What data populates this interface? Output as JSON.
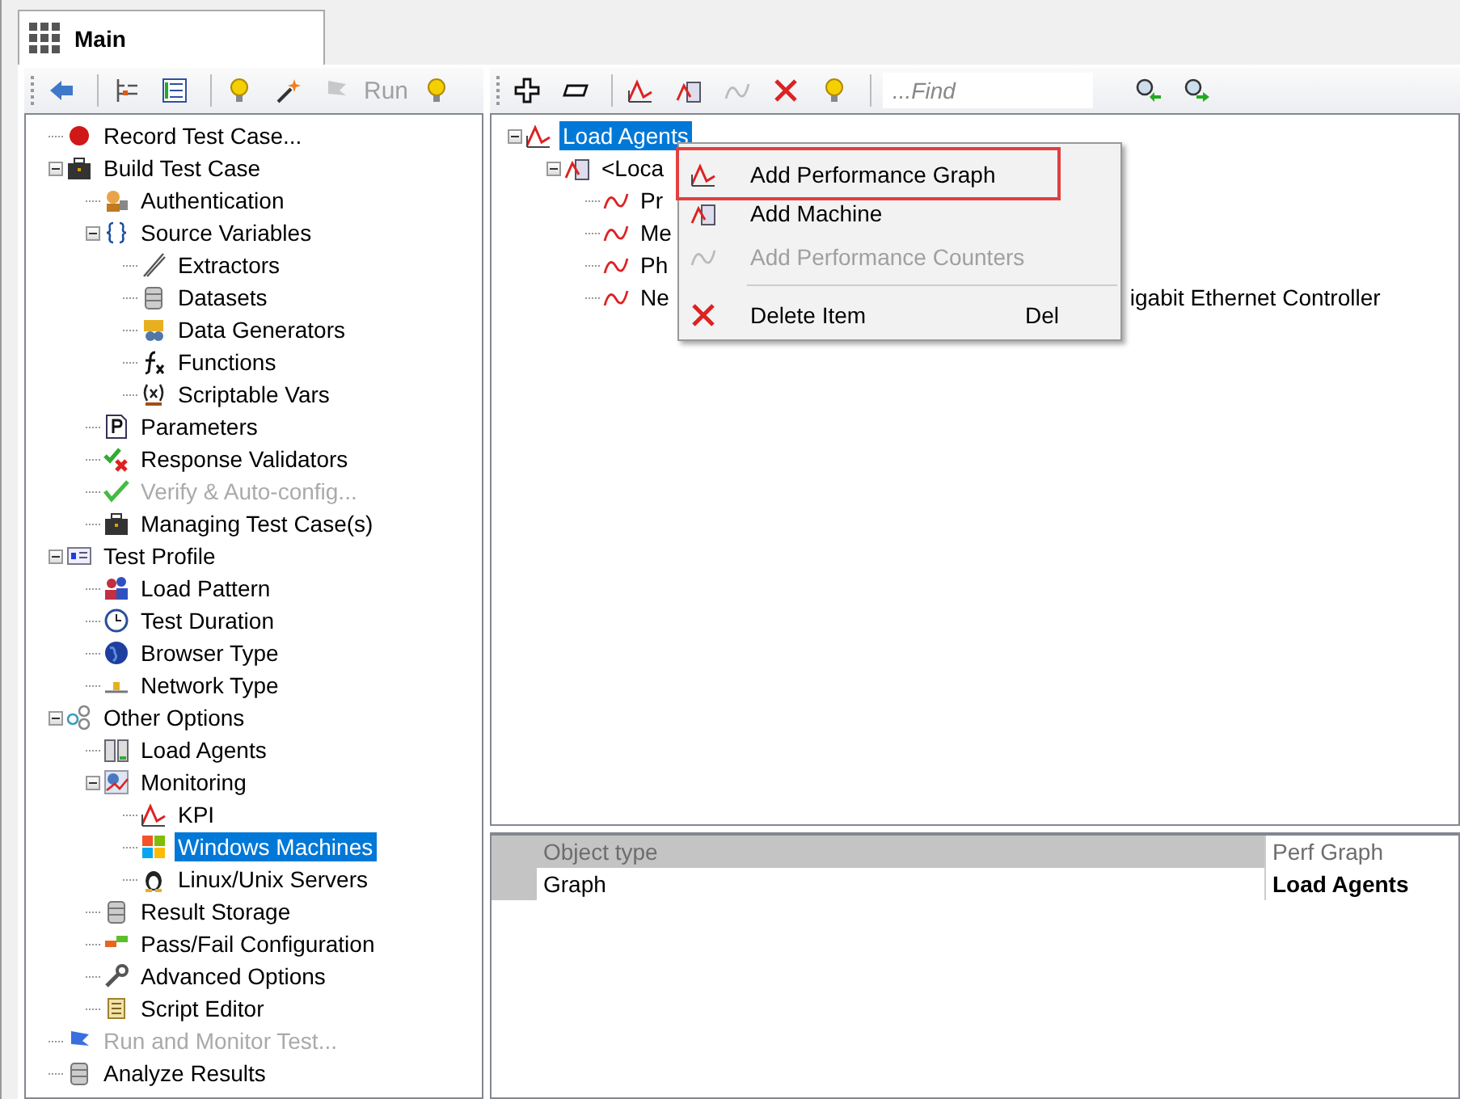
{
  "tabs": [
    {
      "label": "Main",
      "selected": true
    }
  ],
  "left_toolbar": {
    "run_label": "Run",
    "run_disabled": true
  },
  "left_tree": [
    {
      "label": "Record Test Case...",
      "disabled": false,
      "selected": false
    },
    {
      "label": "Build Test Case",
      "disabled": false,
      "selected": false,
      "expanded": true,
      "children": [
        {
          "label": "Authentication",
          "disabled": false,
          "selected": false
        },
        {
          "label": "Source Variables",
          "disabled": false,
          "selected": false,
          "expanded": true,
          "children": [
            {
              "label": "Extractors",
              "disabled": false,
              "selected": false
            },
            {
              "label": "Datasets",
              "disabled": false,
              "selected": false
            },
            {
              "label": "Data Generators",
              "disabled": false,
              "selected": false
            },
            {
              "label": "Functions",
              "disabled": false,
              "selected": false
            },
            {
              "label": "Scriptable Vars",
              "disabled": false,
              "selected": false
            }
          ]
        },
        {
          "label": "Parameters",
          "disabled": false,
          "selected": false
        },
        {
          "label": "Response Validators",
          "disabled": false,
          "selected": false
        },
        {
          "label": "Verify & Auto-config...",
          "disabled": true,
          "selected": false
        },
        {
          "label": "Managing Test Case(s)",
          "disabled": false,
          "selected": false
        }
      ]
    },
    {
      "label": "Test Profile",
      "disabled": false,
      "selected": false,
      "expanded": true,
      "children": [
        {
          "label": "Load Pattern",
          "disabled": false,
          "selected": false
        },
        {
          "label": "Test Duration",
          "disabled": false,
          "selected": false
        },
        {
          "label": "Browser Type",
          "disabled": false,
          "selected": false
        },
        {
          "label": "Network Type",
          "disabled": false,
          "selected": false
        }
      ]
    },
    {
      "label": "Other Options",
      "disabled": false,
      "selected": false,
      "expanded": true,
      "children": [
        {
          "label": "Load Agents",
          "disabled": false,
          "selected": false
        },
        {
          "label": "Monitoring",
          "disabled": false,
          "selected": false,
          "expanded": true,
          "children": [
            {
              "label": "KPI",
              "disabled": false,
              "selected": false
            },
            {
              "label": "Windows Machines",
              "disabled": false,
              "selected": true
            },
            {
              "label": "Linux/Unix Servers",
              "disabled": false,
              "selected": false
            }
          ]
        },
        {
          "label": "Result Storage",
          "disabled": false,
          "selected": false
        },
        {
          "label": "Pass/Fail Configuration",
          "disabled": false,
          "selected": false
        },
        {
          "label": "Advanced Options",
          "disabled": false,
          "selected": false
        },
        {
          "label": "Script Editor",
          "disabled": false,
          "selected": false
        }
      ]
    },
    {
      "label": "Run and Monitor Test...",
      "disabled": true,
      "selected": false
    },
    {
      "label": "Analyze Results",
      "disabled": false,
      "selected": false
    }
  ],
  "right_toolbar": {
    "find_placeholder": "...Find"
  },
  "right_tree": [
    {
      "label": "Load Agents",
      "selected": true,
      "expanded": true,
      "children": [
        {
          "label": "<Loca",
          "selected": false,
          "expanded": true,
          "children": [
            {
              "label": "Pr",
              "selected": false
            },
            {
              "label": "Me",
              "selected": false
            },
            {
              "label": "Ph",
              "selected": false
            },
            {
              "label": "Ne",
              "tail": "igabit Ethernet Controller",
              "selected": false
            }
          ]
        }
      ]
    }
  ],
  "context_menu": [
    {
      "kind": "item",
      "label": "Add Performance Graph",
      "disabled": false,
      "highlighted": true
    },
    {
      "kind": "item",
      "label": "Add Machine",
      "disabled": false,
      "highlighted": false
    },
    {
      "kind": "item",
      "label": "Add Performance Counters",
      "disabled": true,
      "highlighted": false
    },
    {
      "kind": "separator"
    },
    {
      "kind": "item",
      "label": "Delete Item",
      "shortcut": "Del",
      "disabled": false,
      "highlighted": false
    }
  ],
  "properties": {
    "header": [
      "Object type",
      "Perf Graph"
    ],
    "rows": [
      [
        "Graph",
        "Load Agents"
      ]
    ]
  }
}
